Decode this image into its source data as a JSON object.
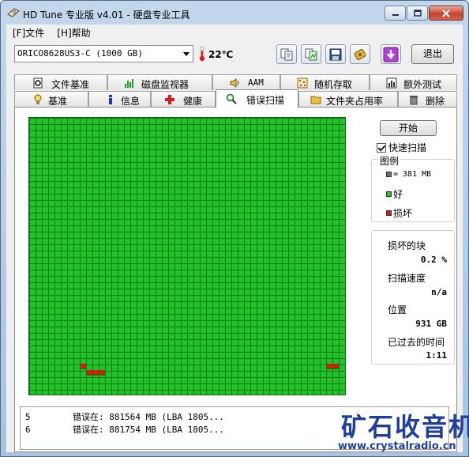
{
  "window": {
    "title": "HD Tune 专业版 v4.01 - 硬盘专业工具"
  },
  "menu": {
    "items": [
      "[F]文件",
      "[H]帮助"
    ]
  },
  "toolbar": {
    "drive": "ORICO8628US3-C (1000 GB)",
    "temperature": "22℃",
    "buttons": [
      "copy-text-icon",
      "copy-screenshot-icon",
      "save-icon",
      "options-icon",
      "download-icon"
    ],
    "exit_label": "退出"
  },
  "tabs": {
    "upper": [
      {
        "label": "文件基准",
        "icon": "file-benchmark-icon"
      },
      {
        "label": "磁盘监视器",
        "icon": "disk-monitor-icon"
      },
      {
        "label": "AAM",
        "icon": "speaker-icon"
      },
      {
        "label": "随机存取",
        "icon": "random-access-icon"
      },
      {
        "label": "额外测试",
        "icon": "extra-tests-icon"
      }
    ],
    "lower": [
      {
        "label": "基准",
        "icon": "lightbulb-icon"
      },
      {
        "label": "信息",
        "icon": "info-icon"
      },
      {
        "label": "健康",
        "icon": "health-cross-icon"
      },
      {
        "label": "错误扫描",
        "icon": "magnifier-icon",
        "active": true
      },
      {
        "label": "文件夹占用率",
        "icon": "folder-icon"
      },
      {
        "label": "删除",
        "icon": "trash-icon"
      }
    ]
  },
  "scan": {
    "start_label": "开始",
    "quick_scan_label": "快速扫描",
    "quick_scan_checked": true,
    "grid": {
      "columns": 50,
      "rows": 44,
      "bad_blocks": [
        [
          8,
          39
        ],
        [
          9,
          40
        ],
        [
          10,
          40
        ],
        [
          11,
          40
        ],
        [
          47,
          39
        ],
        [
          48,
          39
        ]
      ]
    },
    "legend": {
      "title": "图例",
      "block_size": "= 381 MB",
      "good": "好",
      "bad": "损坏",
      "colors": {
        "block": "#6e6e6e",
        "good": "#22c22a",
        "bad": "#ee1010"
      }
    },
    "stats": {
      "damaged_label": "损坏的块",
      "damaged_value": "0.2 %",
      "speed_label": "扫描速度",
      "speed_value": "n/a",
      "position_label": "位置",
      "position_value": "931 GB",
      "elapsed_label": "已过去的时间",
      "elapsed_value": "1:11"
    },
    "log": [
      {
        "num": "5",
        "text": "错误在:  881564 MB  (LBA 1805..."
      },
      {
        "num": "6",
        "text": "错误在:  881754 MB  (LBA 1805..."
      }
    ]
  },
  "watermark": {
    "cn": "矿石收音机",
    "url": "www.crystalradio.cn"
  }
}
